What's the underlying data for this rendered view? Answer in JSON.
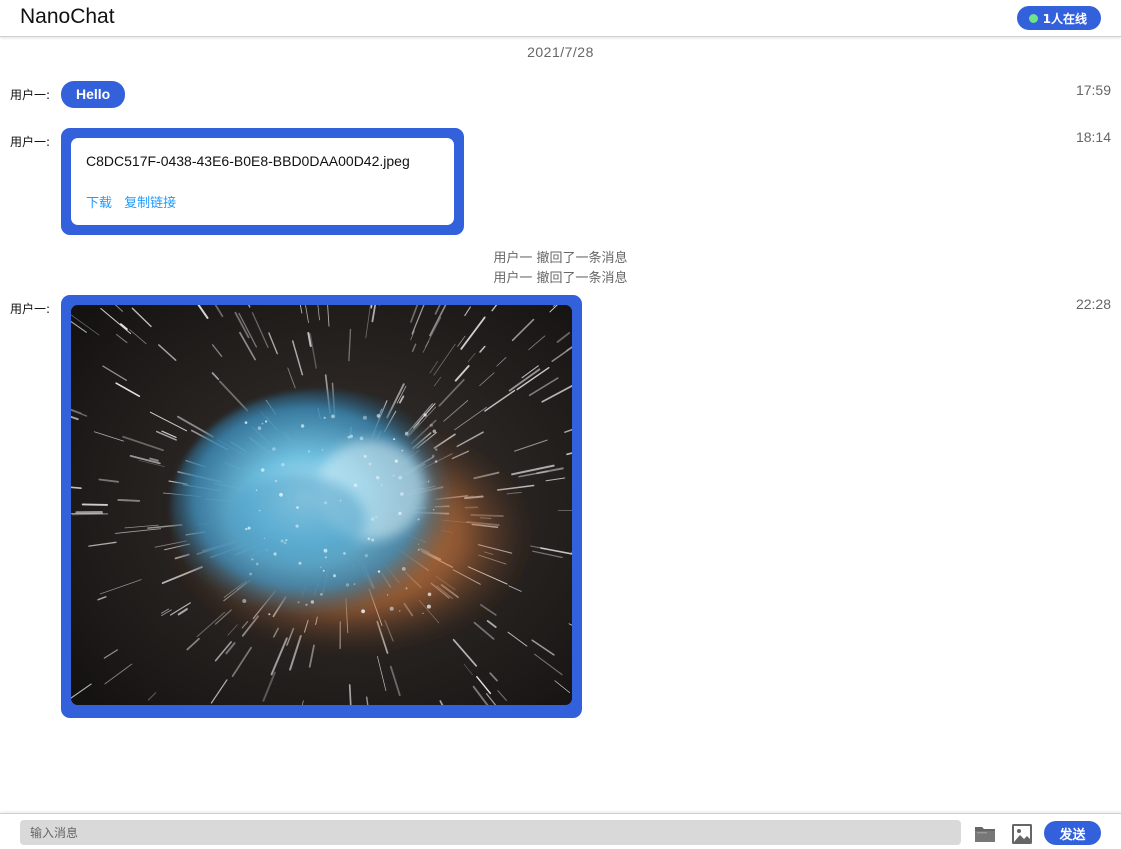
{
  "header": {
    "title": "NanoChat",
    "online_label": "1人在线"
  },
  "chat": {
    "date_separator": "2021/7/28",
    "messages": [
      {
        "sender": "用户一:",
        "type": "text",
        "text": "Hello",
        "time": "17:59"
      },
      {
        "sender": "用户一:",
        "type": "file",
        "file_name": "C8DC517F-0438-43E6-B0E8-BBD0DAA00D42.jpeg",
        "download_label": "下载",
        "copy_link_label": "复制链接",
        "time": "18:14"
      },
      {
        "sender": "用户一:",
        "type": "image",
        "time": "22:28"
      }
    ],
    "recall_notices": [
      "用户一 撤回了一条消息",
      "用户一 撤回了一条消息"
    ]
  },
  "composer": {
    "placeholder": "输入消息",
    "value": "",
    "send_label": "发送",
    "file_icon": "folder-icon",
    "image_icon": "image-icon"
  },
  "colors": {
    "accent": "#3360db",
    "online_dot": "#6fe38a",
    "link": "#1e9bff"
  }
}
